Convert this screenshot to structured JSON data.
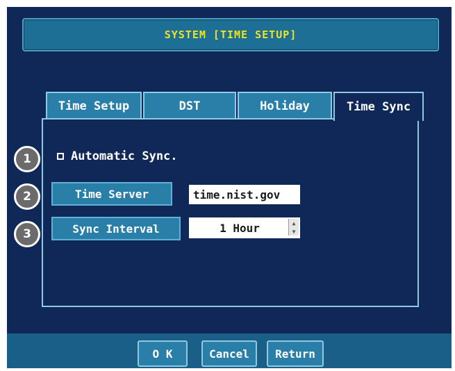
{
  "title": "SYSTEM [TIME SETUP]",
  "tabs": [
    {
      "label": "Time Setup",
      "active": false
    },
    {
      "label": "DST",
      "active": false
    },
    {
      "label": "Holiday",
      "active": false
    },
    {
      "label": "Time Sync",
      "active": true
    }
  ],
  "callouts": [
    "1",
    "2",
    "3"
  ],
  "settings": {
    "auto_sync": {
      "label": "Automatic Sync.",
      "checked": true
    },
    "time_server": {
      "label": "Time Server",
      "value": "time.nist.gov"
    },
    "sync_interval": {
      "label": "Sync Interval",
      "value": "1 Hour"
    }
  },
  "buttons": {
    "ok": "O K",
    "cancel": "Cancel",
    "return": "Return"
  },
  "colors": {
    "background": "#0f2858",
    "tab": "#2a7fa8",
    "title_text": "#e8e42e"
  }
}
